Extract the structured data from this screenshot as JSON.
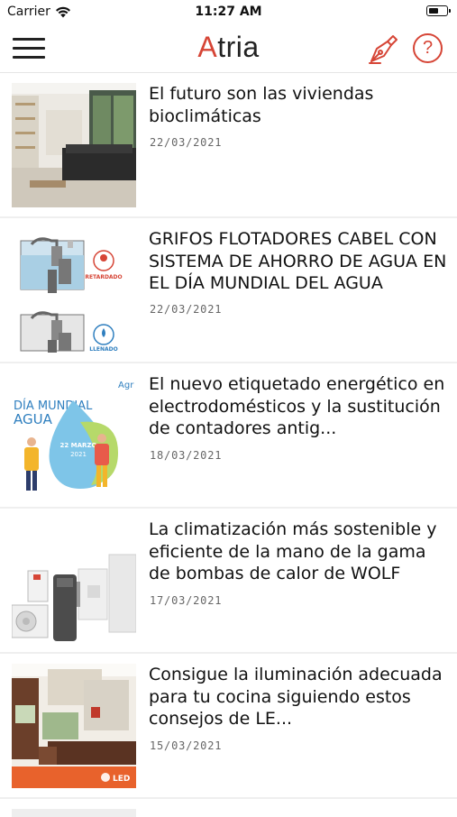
{
  "statusbar": {
    "carrier": "Carrier",
    "time": "11:27 AM",
    "battery_level": 0.6
  },
  "navbar": {
    "logo_first": "A",
    "logo_rest": "tria",
    "accent_color": "#d64536",
    "menu_icon": "hamburger-icon",
    "pen_icon": "fountain-pen-icon",
    "help_label": "?"
  },
  "articles": [
    {
      "title": "El futuro son las viviendas bioclimáticas",
      "date": "22/03/2021"
    },
    {
      "title": "GRIFOS FLOTADORES CABEL CON SISTEMA DE AHORRO DE AGUA EN EL DÍA MUNDIAL DEL AGUA",
      "date": "22/03/2021"
    },
    {
      "title": "El nuevo etiquetado energético en electrodomésticos y la sustitución de contadores antig...",
      "date": "18/03/2021"
    },
    {
      "title": "La climatización más sostenible y eficiente de la mano de la gama de bombas de calor de WOLF",
      "date": "17/03/2021"
    },
    {
      "title": "Consigue la iluminación adecuada para tu cocina siguiendo estos consejos de LE...",
      "date": "15/03/2021"
    }
  ],
  "thumb_texts": {
    "retardado": "RETARDADO",
    "llenado": "LLENADO",
    "dia_mundial": "DÍA MUNDIAL",
    "agua": "AGUA",
    "fecha": "22 MARZO",
    "year": "2021",
    "agr": "Agr",
    "led": "LED"
  }
}
